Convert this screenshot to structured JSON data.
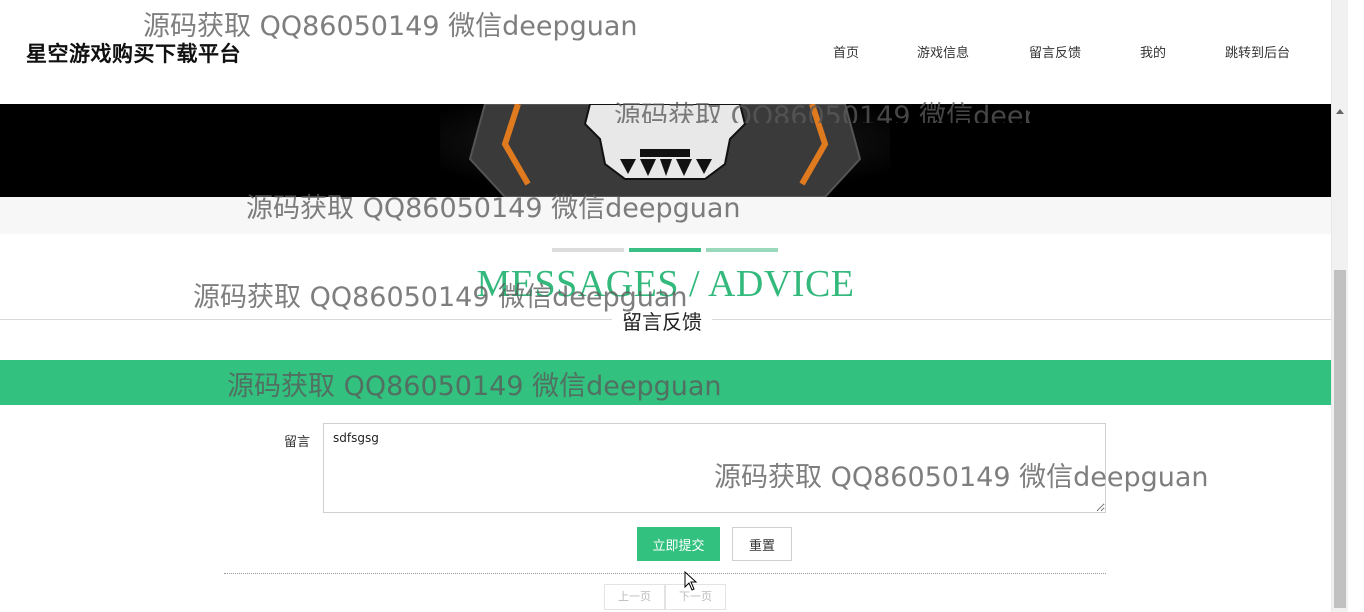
{
  "header": {
    "site_title": "星空游戏购买下载平台",
    "nav": [
      "首页",
      "游戏信息",
      "留言反馈",
      "我的",
      "跳转到后台"
    ]
  },
  "section": {
    "heading_en": "MESSAGES / ADVICE",
    "heading_cn": "留言反馈"
  },
  "form": {
    "message_label": "留言",
    "message_value": "sdfsgsg",
    "submit_label": "立即提交",
    "reset_label": "重置"
  },
  "pagination": {
    "prev_label": "上一页",
    "next_label": "下一页"
  },
  "watermark": {
    "text": "源码获取 QQ86050149 微信deepguan"
  },
  "colors": {
    "accent": "#33c17f",
    "heading_green": "#34b97c",
    "banner_bg": "#000000",
    "skull_orange": "#e07a1f"
  }
}
